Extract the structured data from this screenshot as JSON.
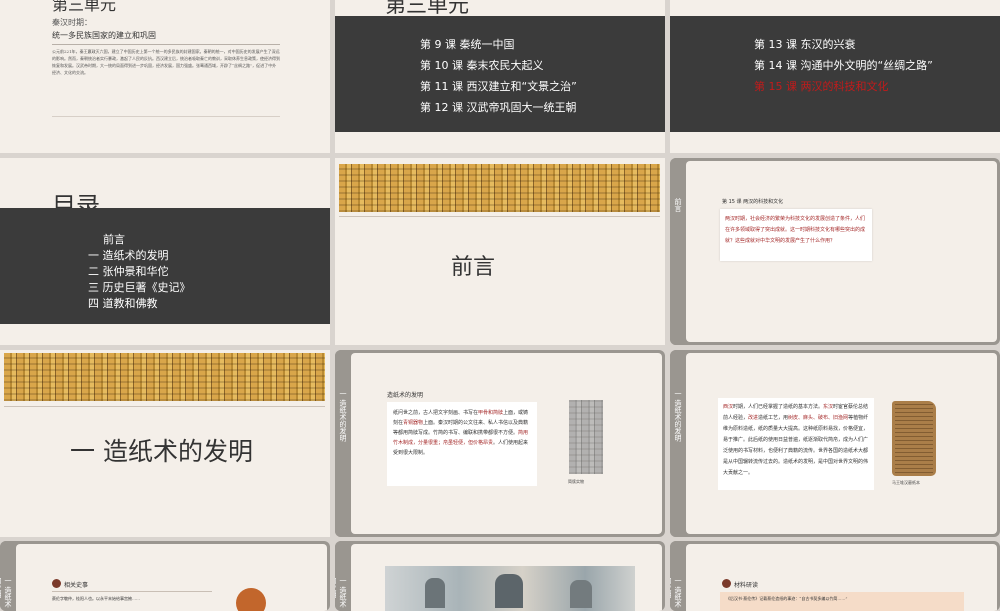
{
  "slide1": {
    "unit_title": "第三单元",
    "period": "秦汉时期：",
    "subtitle": "统一多民族国家的建立和巩固",
    "body": "公元前221年，秦王嬴政灭六国，建立了中国历史上第一个统一的多民族的封建国家。秦朝的统一，对中国历史的发展产生了深远的影响。然而，秦朝统治者实行暴政，激起了人民的反抗。西汉建立后，统治者吸取秦亡的教训，采取休养生息政策，使经济得到恢复和发展。汉武帝时期，大一统的局面得到进一步巩固，经济发展，国力强盛。张骞通西域，开辟了“丝绸之路”，促进了中外经济、文化的交流。"
  },
  "slide2": {
    "unit_title": "第三单元",
    "lessons": [
      "第 9 课  秦统一中国",
      "第 10 课  秦末农民大起义",
      "第 11 课  西汉建立和“文景之治”",
      "第 12 课  汉武帝巩固大一统王朝"
    ]
  },
  "slide3": {
    "lessons": [
      "第 13 课  东汉的兴衰",
      "第 14 课  沟通中外文明的“丝绸之路”",
      "第 15 课  两汉的科技和文化"
    ]
  },
  "slide4": {
    "title": "目录",
    "items": [
      "前言",
      "一  造纸术的发明",
      "二  张仲景和华佗",
      "三  历史巨著《史记》",
      "四  道教和佛教"
    ]
  },
  "slide5": {
    "title": "前言"
  },
  "slide6": {
    "strip": "前言",
    "lesson": "第 15 课 两汉的科技和文化",
    "body": "两汉时期，社会经济的繁荣为科技文化的发展创造了条件，人们在许多领域取得了突出成就。这一时期科技文化有哪些突出的成就？这些成就对中华文明的发展产生了什么作用？"
  },
  "slide7": {
    "title": "一  造纸术的发明"
  },
  "slide8": {
    "strip": "一 造纸术的发明",
    "heading": "造纸术的发明",
    "body_parts": [
      "纸问世之前，古人把文字刻画、书写在",
      "甲骨和简牍",
      "上面，或铸刻在",
      "青铜器物",
      "上面。秦汉时期的公文往来、私人书信以及典籍等都用简牍写成。",
      "竹简的书写、编联和携带都很不方便。",
      "简用竹木制成，分量很重；帛虽轻便，但价格昂贵",
      "。人们使用起来受到很大限制。"
    ],
    "image_caption": "简牍实物"
  },
  "slide9": {
    "strip": "一 造纸术的发明",
    "body_parts": [
      "西汉",
      "时期，人们已经掌握了造纸的基本方法。",
      "东汉",
      "时宦官蔡伦总结前人经验，",
      "改进",
      "造纸工艺，用",
      "树皮、麻头、破布、旧渔网",
      "等植物纤维为原料造纸，纸的质量大大提高。这种纸原料易找，价格便宜，易于推广。此后纸的使用日益普遍，纸逐渐取代简帛，成为人们广泛使用的书写材料，也便利了典籍的流传。世界各国的造纸术大都是从中国辗转流传过去的。造纸术的发明，是中国对世界文明的伟大贡献之一。"
    ],
    "image_caption": "马王堆汉墓纸本"
  },
  "slide10": {
    "strip": "一 造纸术的发明",
    "heading": "相关史事",
    "body": "蔡伦字敬仲，桂阳人也。以永平末始给事宫掖……"
  },
  "slide11": {
    "strip": "一 造纸术的发明"
  },
  "slide12": {
    "strip": "一 造纸术的发明",
    "heading": "材料研读",
    "body": "《后汉书·蔡伦传》记载蔡伦造纸的事迹：“自古书契多编以竹简……”"
  }
}
